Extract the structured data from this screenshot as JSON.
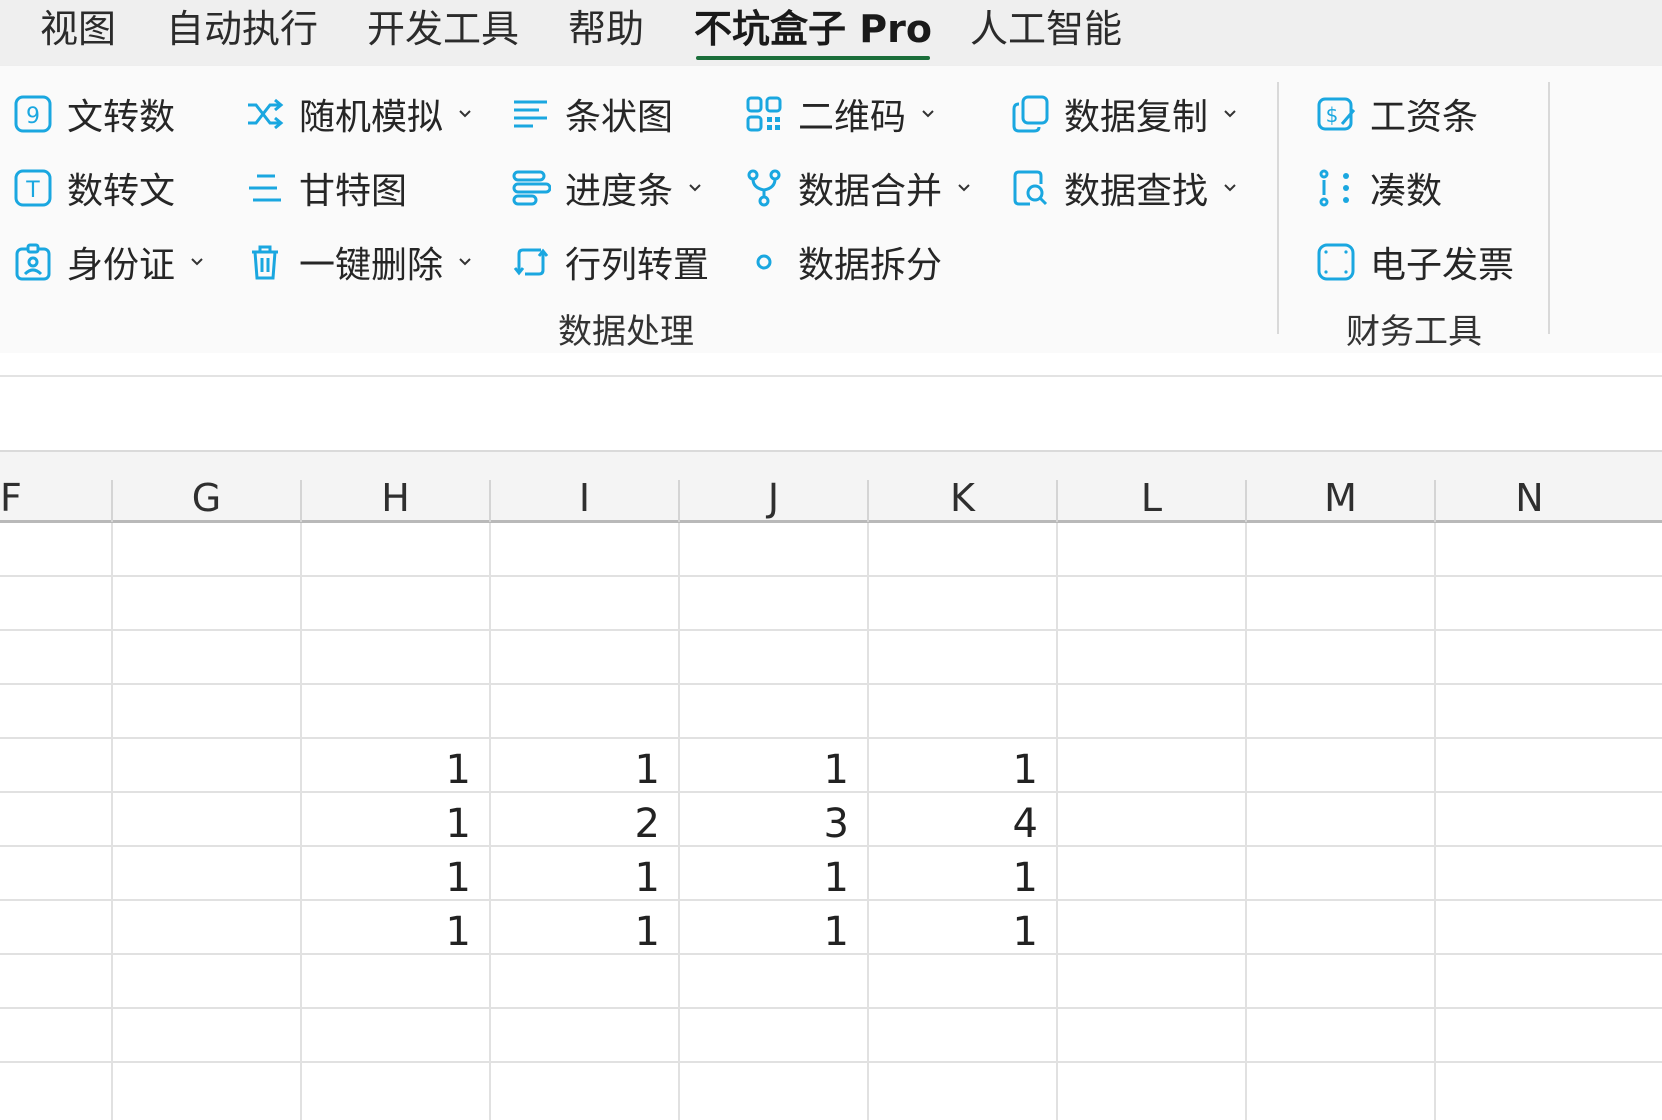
{
  "tabs": [
    {
      "label": "视图"
    },
    {
      "label": "自动执行"
    },
    {
      "label": "开发工具"
    },
    {
      "label": "帮助"
    },
    {
      "label": "不坑盒子 Pro",
      "active": true
    },
    {
      "label": "人工智能"
    }
  ],
  "ribbon": {
    "data_group": {
      "label": "数据处理",
      "items": [
        {
          "label": "文转数",
          "icon": "number-box-icon",
          "dropdown": false
        },
        {
          "label": "数转文",
          "icon": "text-box-icon",
          "dropdown": false
        },
        {
          "label": "身份证",
          "icon": "id-card-icon",
          "dropdown": true
        },
        {
          "label": "随机模拟",
          "icon": "shuffle-icon",
          "dropdown": true
        },
        {
          "label": "甘特图",
          "icon": "gantt-icon",
          "dropdown": false
        },
        {
          "label": "一键删除",
          "icon": "trash-icon",
          "dropdown": true
        },
        {
          "label": "条状图",
          "icon": "bar-list-icon",
          "dropdown": false
        },
        {
          "label": "进度条",
          "icon": "progress-bar-icon",
          "dropdown": true
        },
        {
          "label": "行列转置",
          "icon": "transpose-icon",
          "dropdown": false
        },
        {
          "label": "二维码",
          "icon": "qr-code-icon",
          "dropdown": true
        },
        {
          "label": "数据合并",
          "icon": "merge-icon",
          "dropdown": true
        },
        {
          "label": "数据拆分",
          "icon": "split-dot-icon",
          "dropdown": false
        },
        {
          "label": "数据复制",
          "icon": "copy-icon",
          "dropdown": true
        },
        {
          "label": "数据查找",
          "icon": "search-doc-icon",
          "dropdown": true
        }
      ]
    },
    "finance_group": {
      "label": "财务工具",
      "items": [
        {
          "label": "工资条",
          "icon": "salary-slip-icon",
          "dropdown": false
        },
        {
          "label": "凑数",
          "icon": "dots-icon",
          "dropdown": false
        },
        {
          "label": "电子发票",
          "icon": "invoice-icon",
          "dropdown": false
        }
      ]
    }
  },
  "sheet": {
    "columns": [
      "F",
      "G",
      "H",
      "I",
      "J",
      "K",
      "L",
      "M",
      "N"
    ],
    "rows": [
      [
        "",
        "",
        "",
        "",
        "",
        "",
        "",
        "",
        ""
      ],
      [
        "",
        "",
        "",
        "",
        "",
        "",
        "",
        "",
        ""
      ],
      [
        "",
        "",
        "",
        "",
        "",
        "",
        "",
        "",
        ""
      ],
      [
        "",
        "",
        "",
        "",
        "",
        "",
        "",
        "",
        ""
      ],
      [
        "",
        "",
        "1",
        "1",
        "1",
        "1",
        "",
        "",
        ""
      ],
      [
        "",
        "",
        "1",
        "2",
        "3",
        "4",
        "",
        "",
        ""
      ],
      [
        "",
        "",
        "1",
        "1",
        "1",
        "1",
        "",
        "",
        ""
      ],
      [
        "",
        "",
        "1",
        "1",
        "1",
        "1",
        "",
        "",
        ""
      ],
      [
        "",
        "",
        "",
        "",
        "",
        "",
        "",
        "",
        ""
      ],
      [
        "",
        "",
        "",
        "",
        "",
        "",
        "",
        "",
        ""
      ]
    ]
  },
  "colors": {
    "accent": "#1aa7e0",
    "active_tab_underline": "#1b6e3a"
  }
}
